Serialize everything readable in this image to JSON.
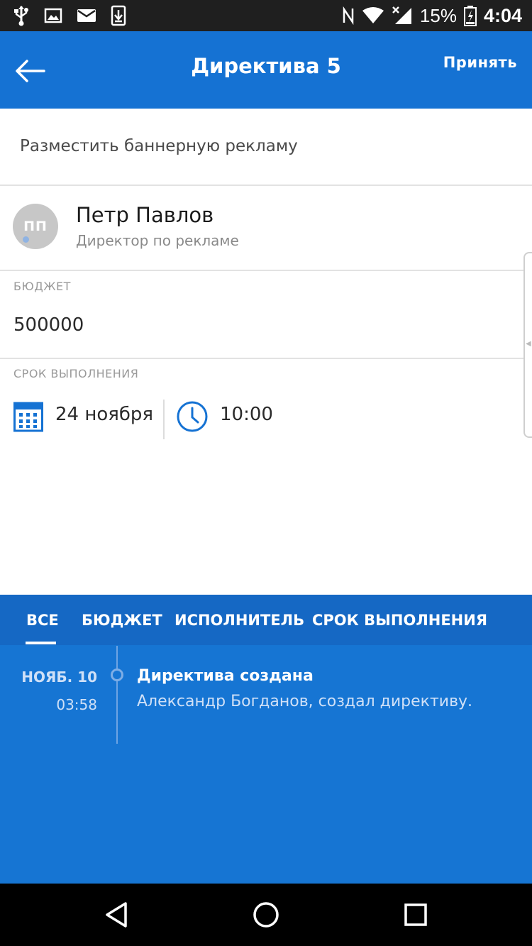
{
  "status_bar": {
    "battery": "15%",
    "time": "4:04",
    "left_icons": [
      "usb-icon",
      "image-icon",
      "mail-icon",
      "download-icon"
    ],
    "right_icons": [
      "nfc-icon",
      "wifi-icon",
      "signal-icon",
      "battery-icon"
    ]
  },
  "app_bar": {
    "title": "Директива 5",
    "accept_label": "Принять"
  },
  "task": {
    "text": "Разместить баннерную рекламу"
  },
  "person": {
    "initials": "ПП",
    "name": "Петр Павлов",
    "role": "Директор по рекламе"
  },
  "budget": {
    "label": "БЮДЖЕТ",
    "value": "500000"
  },
  "deadline": {
    "label": "СРОК ВЫПОЛНЕНИЯ",
    "date": "24 ноября",
    "time": "10:00"
  },
  "history": {
    "tabs": [
      {
        "label": "ВСЕ"
      },
      {
        "label": "БЮДЖЕТ"
      },
      {
        "label": "ИСПОЛНИТЕЛЬ"
      },
      {
        "label": "СРОК ВЫПОЛНЕНИЯ"
      }
    ],
    "active_tab": 0,
    "events": [
      {
        "date": "НОЯБ. 10",
        "time": "03:58",
        "title": "Директива создана",
        "description": "Александр Богданов, создал директиву."
      }
    ]
  },
  "colors": {
    "primary": "#1572d3",
    "tab_bar": "#1568c4",
    "panel": "#1675d3",
    "status_bar": "#1f1f1f"
  }
}
